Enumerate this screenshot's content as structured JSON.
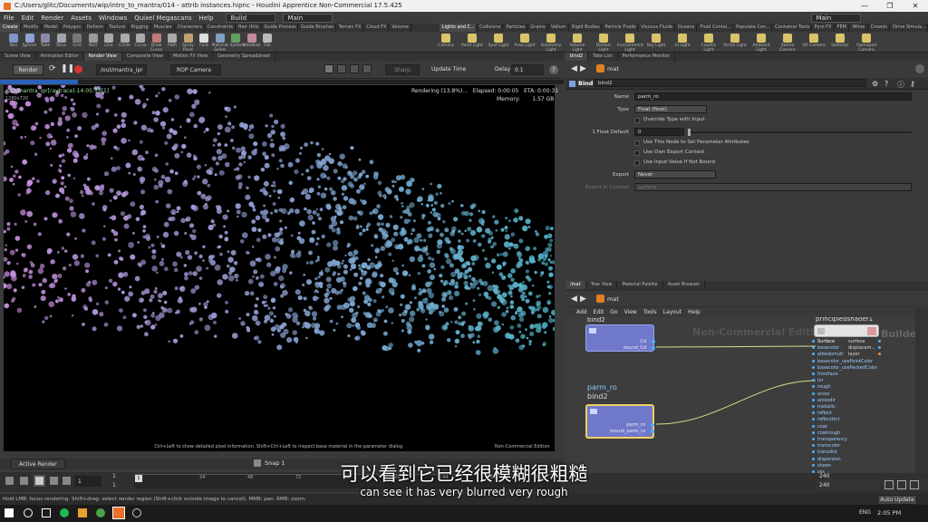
{
  "window": {
    "title": "C:/Users/glitc/Documents/wip/intro_to_mantra/014 - attrib instances.hipnc - Houdini Apprentice Non-Commercial 17.5.425"
  },
  "menubar": {
    "items": [
      "File",
      "Edit",
      "Render",
      "Assets",
      "Windows",
      "Quixel Megascans",
      "Help"
    ],
    "desktop": "Build",
    "main": "Main",
    "right_main": "Main"
  },
  "shelf": {
    "tabs": [
      "Create",
      "Modify",
      "Model",
      "Polygon",
      "Deform",
      "Texture",
      "Rigging",
      "Muscles",
      "Characters",
      "Constraints",
      "Hair Utils",
      "Guide Process",
      "Guide Brushes",
      "Terrain FX",
      "Cloud FX",
      "Volume"
    ],
    "tabs_right": [
      "Lights and C...",
      "Collisions",
      "Particles",
      "Grains",
      "Vellum",
      "Rigid Bodies",
      "Particle Fluids",
      "Viscous Fluids",
      "Oceans",
      "Fluid Contai...",
      "Populate Con...",
      "Container Tools",
      "Pyro FX",
      "FEM",
      "Wires",
      "Crowds",
      "Drive Simula..."
    ],
    "tools": [
      "Box",
      "Sphere",
      "Tube",
      "Torus",
      "Grid",
      "Null",
      "Line",
      "Circle",
      "Curve",
      "Draw Curve",
      "Path",
      "Spray Paint",
      "Font",
      "Platonic Solids",
      "L-System",
      "Metaball",
      "File"
    ],
    "tools_right": [
      "Camera",
      "Point Light",
      "Spot Light",
      "Area Light",
      "Geometry Light",
      "Volume Light",
      "Distant Light",
      "Environment Light",
      "Sky Light",
      "GI Light",
      "Caustic Light",
      "Portal Light",
      "Ambient Light",
      "Stereo Camera",
      "VR Camera",
      "Switcher",
      "Gamepad Camera"
    ]
  },
  "left": {
    "tabs": [
      "Scene View",
      "Animation Editor",
      "Render View",
      "Composite View",
      "Motion FX View",
      "Geometry Spreadsheet"
    ],
    "render_button": "Render",
    "path": "/out/mantra_ipr",
    "camera": "ROP Camera",
    "sharp": "Sharp",
    "update_time": "Update Time",
    "delay_label": "Delay",
    "delay_value": "0.1",
    "progress": 0.138,
    "viewport": {
      "path": "/out/mantra_ipr[raytrace]-14:05:33[1]",
      "res": "1280x720",
      "rendering": "Rendering (13.8%)...",
      "elapsed": "Elapsed: 0:00:05",
      "eta": "ETA: 0:00:31",
      "memory_label": "Memory:",
      "memory": "1.57 GB",
      "hint": "Ctrl+Left to show detailed pixel information. Shift+Ctrl+Left to inspect base material in the parameter dialog.",
      "nc": "Non-Commercial Edition"
    },
    "active_render": "Active Render",
    "snap": "Snap 1"
  },
  "timeline": {
    "frame": "1",
    "start": "1",
    "end": "1",
    "ticks": [
      "24",
      "48",
      "72",
      "96",
      "120",
      "144",
      "168",
      "192",
      "216"
    ],
    "end_a": "240",
    "end_b": "240",
    "auto_update": "Auto Update"
  },
  "status": "Hold LMB: focus rendering. Shift+drag: select render region (Shift+click outside image to cancel). MMB: pan. RMB: zoom.",
  "right": {
    "tabs": [
      "bind2",
      "Take List",
      "Performance Monitor"
    ],
    "path": "mat",
    "node_type": "Bind",
    "node_name": "bind2",
    "params": {
      "name_label": "Name",
      "name_value": "parm_ro",
      "type_label": "Type",
      "type_value": "Float (float)",
      "override": "Override Type with Input",
      "default_label": "1 Float Default",
      "default_value": "0",
      "use_attribs": "Use This Node to Set Parameter Attributes",
      "use_export": "Use Own Export Context",
      "use_input": "Use Input Value If Not Bound",
      "export_label": "Export",
      "export_value": "Never",
      "context_label": "Export in Context",
      "context_value": "surface"
    },
    "net_tabs": [
      "/mat",
      "Tree View",
      "Material Palette",
      "Asset Browser"
    ],
    "net_path": "mat",
    "net_menu": [
      "Add",
      "Edit",
      "Go",
      "View",
      "Tools",
      "Layout",
      "Help"
    ],
    "watermark": "Non-Commercial Edition",
    "builder": "Builder",
    "node1": {
      "name": "bind2",
      "ports": [
        "Cd",
        "bound_Cd"
      ]
    },
    "node2": {
      "name1": "parm_ro",
      "name2": "bind2",
      "ports": [
        "parm_ro",
        "bound_parm_ro"
      ]
    },
    "shader": {
      "name": "principledshader1",
      "outputs": [
        "surface",
        "displacem...",
        "layer"
      ],
      "inputs": [
        "Surface",
        "basecolor",
        "albedomult",
        "basecolor_usePointColor",
        "basecolor_usePackedColor",
        "frontface",
        "ior",
        "rough",
        "aniso",
        "anisodir",
        "metallic",
        "reflect",
        "reflecttint",
        "coat",
        "coatrough",
        "transparency",
        "transcolor",
        "transdist",
        "dispersion",
        "sheen",
        "sss"
      ]
    }
  },
  "subtitles": {
    "cn": "可以看到它已经很模糊很粗糙",
    "en": "can see it has very blurred very rough"
  },
  "taskbar": {
    "time": "2:05 PM",
    "lang": "ENG"
  }
}
